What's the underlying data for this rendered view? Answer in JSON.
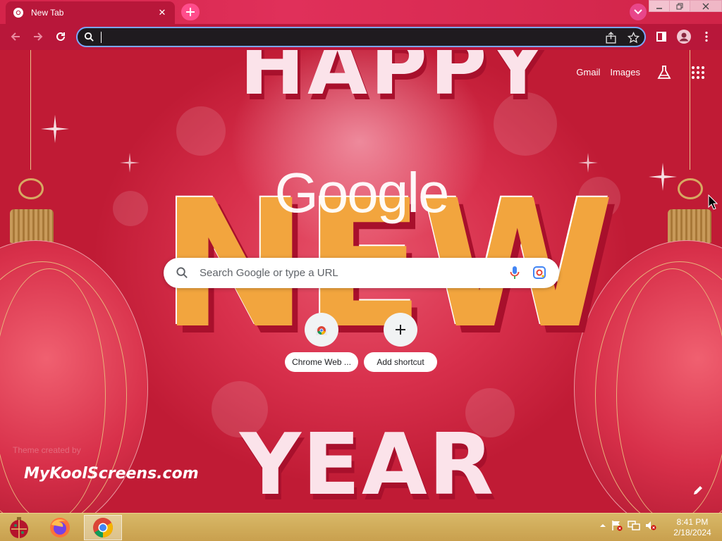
{
  "tab": {
    "title": "New Tab",
    "close_glyph": "✕"
  },
  "toolbar": {
    "address_value": "",
    "icons": [
      "back-icon",
      "forward-icon",
      "reload-icon",
      "search-icon",
      "share-icon",
      "star-icon",
      "side-panel-icon",
      "profile-icon",
      "menu-icon"
    ]
  },
  "ntp": {
    "links": {
      "gmail": "Gmail",
      "images": "Images"
    },
    "logo_text": "Google",
    "search_placeholder": "Search Google or type a URL",
    "shortcuts": [
      {
        "label": "Chrome Web ..."
      },
      {
        "label": "Add shortcut"
      }
    ],
    "theme_credit": "Theme created by",
    "theme_brand": "MyKoolScreens.com"
  },
  "background": {
    "words": {
      "happy": "HAPPY",
      "new": "NEW",
      "year": "YEAR"
    }
  },
  "taskbar": {
    "apps": [
      "ornament-start-icon",
      "firefox-icon",
      "chrome-icon"
    ],
    "time": "8:41 PM",
    "date": "2/18/2024"
  },
  "colors": {
    "tab_strip": "#d4244a",
    "toolbar": "#b8173a",
    "omnibox_bg": "#1f1b1f",
    "omnibox_border": "#7aa7ff",
    "taskbar": "#c9a04e"
  }
}
